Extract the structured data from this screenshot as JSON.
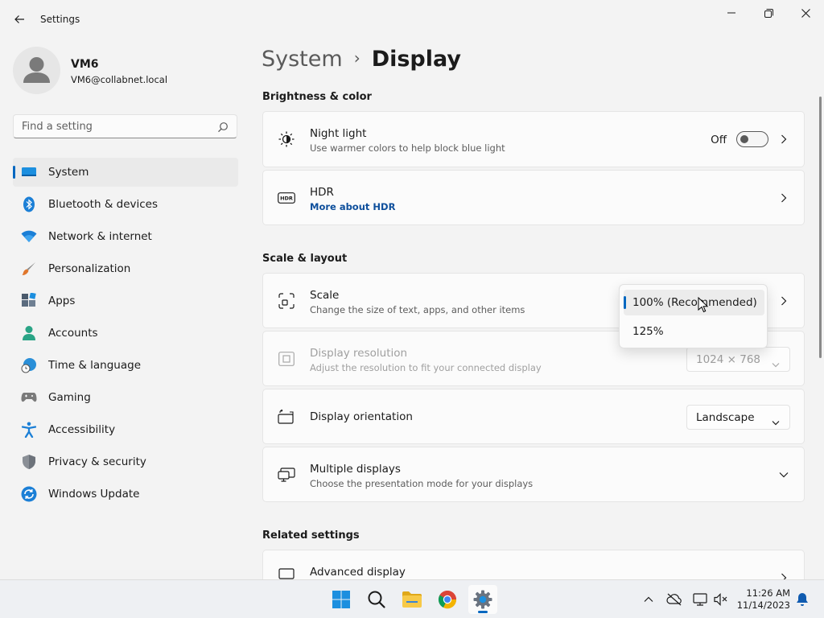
{
  "window": {
    "title": "Settings"
  },
  "profile": {
    "name": "VM6",
    "email": "VM6@collabnet.local"
  },
  "search": {
    "placeholder": "Find a setting"
  },
  "sidebar": {
    "items": [
      {
        "label": "System",
        "icon": "system-icon",
        "active": true
      },
      {
        "label": "Bluetooth & devices",
        "icon": "bluetooth-icon"
      },
      {
        "label": "Network & internet",
        "icon": "wifi-icon"
      },
      {
        "label": "Personalization",
        "icon": "brush-icon"
      },
      {
        "label": "Apps",
        "icon": "apps-icon"
      },
      {
        "label": "Accounts",
        "icon": "accounts-icon"
      },
      {
        "label": "Time & language",
        "icon": "time-language-icon"
      },
      {
        "label": "Gaming",
        "icon": "gamepad-icon"
      },
      {
        "label": "Accessibility",
        "icon": "accessibility-icon"
      },
      {
        "label": "Privacy & security",
        "icon": "shield-icon"
      },
      {
        "label": "Windows Update",
        "icon": "update-icon"
      }
    ]
  },
  "breadcrumb": {
    "parent": "System",
    "separator": "›",
    "current": "Display"
  },
  "sections": {
    "brightness": "Brightness & color",
    "scale_layout": "Scale & layout",
    "related": "Related settings"
  },
  "night_light": {
    "title": "Night light",
    "subtitle": "Use warmer colors to help block blue light",
    "state_label": "Off",
    "enabled": false
  },
  "hdr": {
    "title": "HDR",
    "link": "More about HDR"
  },
  "scale": {
    "title": "Scale",
    "subtitle": "Change the size of text, apps, and other items",
    "options": [
      "100% (Recommended)",
      "125%"
    ],
    "selected": "100% (Recommended)"
  },
  "resolution": {
    "title": "Display resolution",
    "subtitle": "Adjust the resolution to fit your connected display",
    "value": "1024 × 768"
  },
  "orientation": {
    "title": "Display orientation",
    "value": "Landscape"
  },
  "multiple_displays": {
    "title": "Multiple displays",
    "subtitle": "Choose the presentation mode for your displays"
  },
  "advanced_display": {
    "title": "Advanced display"
  },
  "taskbar": {
    "time": "11:26 AM",
    "date": "11/14/2023"
  },
  "colors": {
    "accent": "#0067c0",
    "link": "#0e4f9c"
  }
}
